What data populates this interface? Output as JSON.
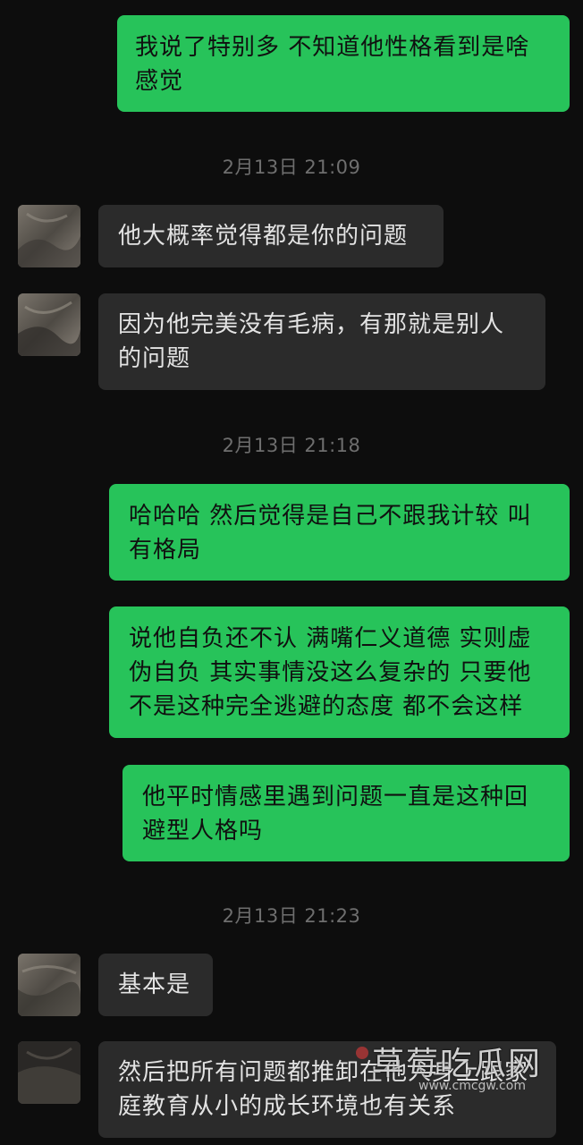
{
  "messages": [
    {
      "id": "m1",
      "side": "me",
      "text": "我说了特别多 不知道他性格看到是啥感觉"
    },
    {
      "id": "m2",
      "side": "them",
      "text": "他大概率觉得都是你的问题"
    },
    {
      "id": "m3",
      "side": "them",
      "text": "因为他完美没有毛病，有那就是别人的问题"
    },
    {
      "id": "m4",
      "side": "me",
      "text": "哈哈哈 然后觉得是自己不跟我计较 叫有格局"
    },
    {
      "id": "m5",
      "side": "me",
      "text": "说他自负还不认 满嘴仁义道德 实则虚伪自负 其实事情没这么复杂的 只要他不是这种完全逃避的态度 都不会这样"
    },
    {
      "id": "m6",
      "side": "me",
      "text": "他平时情感里遇到问题一直是这种回避型人格吗"
    },
    {
      "id": "m7",
      "side": "them",
      "text": "基本是"
    },
    {
      "id": "m8",
      "side": "them",
      "text": "然后把所有问题都推卸在他人身上跟家庭教育从小的成长环境也有关系"
    }
  ],
  "timestamps": [
    {
      "id": "t1",
      "text": "2月13日 21:09"
    },
    {
      "id": "t2",
      "text": "2月13日 21:18"
    },
    {
      "id": "t3",
      "text": "2月13日 21:23"
    }
  ],
  "watermark": {
    "title": "草莓吃瓜网",
    "url": "www.cmcgw.com"
  },
  "colors": {
    "background": "#0d0d0d",
    "my_bubble": "#27c35a",
    "their_bubble": "#2b2b2b",
    "timestamp": "#6e6e6e"
  }
}
